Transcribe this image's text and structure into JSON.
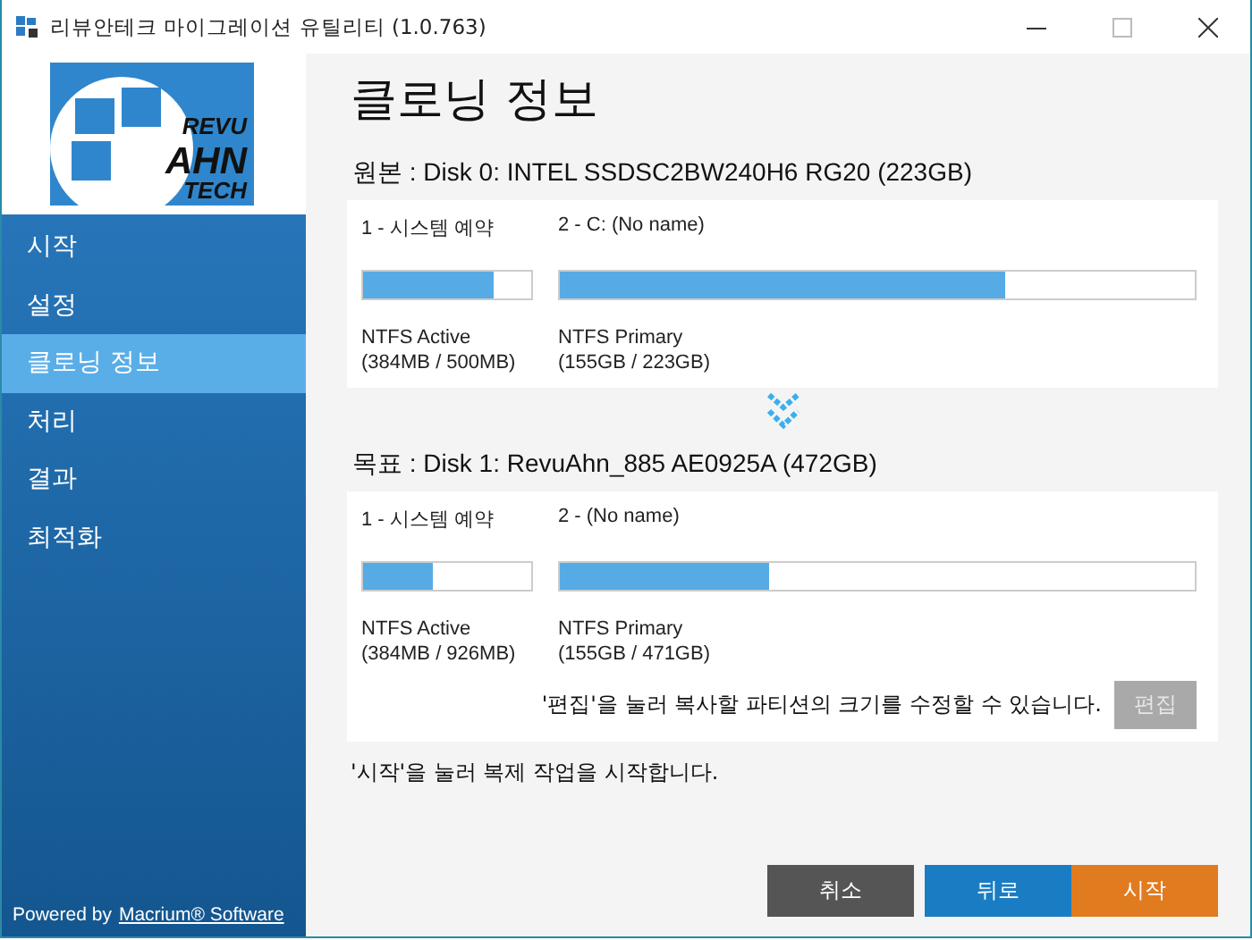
{
  "window": {
    "title": "리뷰안테크 마이그레이션 유틸리티 (1.0.763)"
  },
  "logo": {
    "lines": [
      "REVU",
      "AHN",
      "TECH"
    ]
  },
  "sidebar": {
    "items": [
      {
        "label": "시작",
        "selected": false
      },
      {
        "label": "설정",
        "selected": false
      },
      {
        "label": "클로닝 정보",
        "selected": true
      },
      {
        "label": "처리",
        "selected": false
      },
      {
        "label": "결과",
        "selected": false
      },
      {
        "label": "최적화",
        "selected": false
      }
    ],
    "footer": {
      "prefix": "Powered by",
      "link": "Macrium® Software"
    }
  },
  "main": {
    "heading": "클로닝 정보",
    "disks": [
      {
        "label": "원본 : Disk 0: INTEL SSDSC2BW240H6 RG20 (223GB)",
        "partitions": [
          {
            "title": "1 - 시스템 예약",
            "level": 0.78,
            "type": "NTFS Active",
            "size": "(384MB / 500MB)"
          },
          {
            "title": "2 - C: (No name)",
            "level": 0.7,
            "type": "NTFS Primary",
            "size": "(155GB / 223GB)"
          }
        ]
      },
      {
        "label": "목표 : Disk 1: RevuAhn_885 AE0925A (472GB)",
        "partitions": [
          {
            "title": "1 - 시스템 예약",
            "level": 0.42,
            "type": "NTFS Active",
            "size": "(384MB / 926MB)"
          },
          {
            "title": "2 - (No name)",
            "level": 0.33,
            "type": "NTFS Primary",
            "size": "(155GB / 471GB)"
          }
        ]
      }
    ],
    "edit_hint": "'편집'을 눌러 복사할 파티션의 크기를 수정할 수 있습니다.",
    "edit_button": {
      "label": "편집",
      "disabled": true
    },
    "start_hint": "'시작'을 눌러 복제 작업을 시작합니다.",
    "buttons": [
      {
        "label": "취소",
        "kind": "cancel"
      },
      {
        "label": "뒤로",
        "kind": "back"
      },
      {
        "label": "시작",
        "kind": "start"
      }
    ]
  }
}
